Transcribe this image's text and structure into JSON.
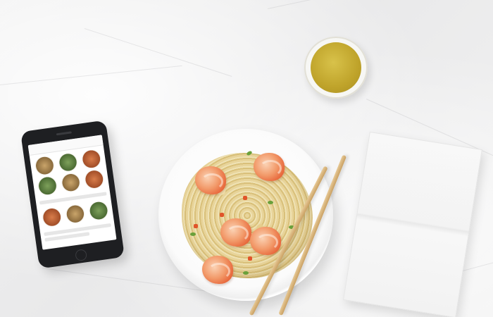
{
  "scene": {
    "background": "#eeeeee",
    "accent_colors": {
      "tea": "#c8ad33",
      "shrimp": "#e86a3e",
      "herb": "#6aa03a",
      "chopsticks": "#d6b27a",
      "phone": "#1e1f22"
    }
  },
  "objects": {
    "phone_icon": "smartphone-icon",
    "tea_icon": "tea-cup-icon",
    "plate_icon": "plate-icon",
    "chopsticks_icon": "chopsticks-icon",
    "napkin_icon": "napkin-icon"
  }
}
